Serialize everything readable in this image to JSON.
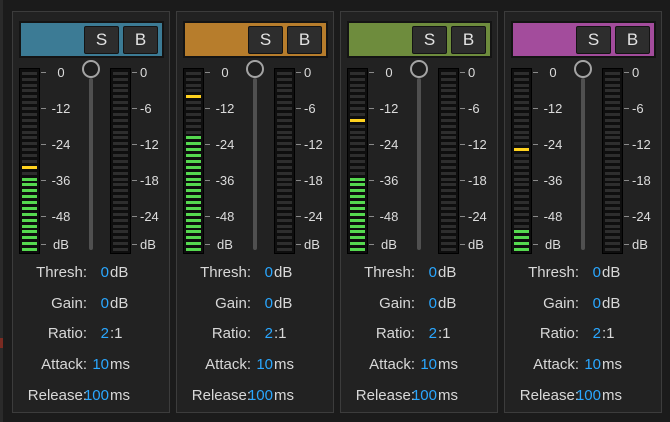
{
  "bands": [
    {
      "color": "#3c7b95",
      "solo_label": "S",
      "bypass_label": "B",
      "input_level_db": -33,
      "input_peak_db": -31,
      "gain_reduction_db": 0,
      "threshold_knob_db": 0,
      "params": {
        "thresh": {
          "label": "Thresh:",
          "value": "0",
          "unit": "dB"
        },
        "gain": {
          "label": "Gain:",
          "value": "0",
          "unit": "dB"
        },
        "ratio": {
          "label": "Ratio:",
          "value": "2",
          "unit": ":1"
        },
        "attack": {
          "label": "Attack:",
          "value": "10",
          "unit": "ms"
        },
        "release": {
          "label": "Release:",
          "value": "100",
          "unit": "ms"
        }
      }
    },
    {
      "color": "#b77d2c",
      "solo_label": "S",
      "bypass_label": "B",
      "input_level_db": -20,
      "input_peak_db": -8,
      "gain_reduction_db": 0,
      "threshold_knob_db": 0,
      "params": {
        "thresh": {
          "label": "Thresh:",
          "value": "0",
          "unit": "dB"
        },
        "gain": {
          "label": "Gain:",
          "value": "0",
          "unit": "dB"
        },
        "ratio": {
          "label": "Ratio:",
          "value": "2",
          "unit": ":1"
        },
        "attack": {
          "label": "Attack:",
          "value": "10",
          "unit": "ms"
        },
        "release": {
          "label": "Release:",
          "value": "100",
          "unit": "ms"
        }
      }
    },
    {
      "color": "#6e8c3d",
      "solo_label": "S",
      "bypass_label": "B",
      "input_level_db": -33,
      "input_peak_db": -16,
      "gain_reduction_db": 0,
      "threshold_knob_db": 0,
      "params": {
        "thresh": {
          "label": "Thresh:",
          "value": "0",
          "unit": "dB"
        },
        "gain": {
          "label": "Gain:",
          "value": "0",
          "unit": "dB"
        },
        "ratio": {
          "label": "Ratio:",
          "value": "2",
          "unit": ":1"
        },
        "attack": {
          "label": "Attack:",
          "value": "10",
          "unit": "ms"
        },
        "release": {
          "label": "Release:",
          "value": "100",
          "unit": "ms"
        }
      }
    },
    {
      "color": "#a34c9c",
      "solo_label": "S",
      "bypass_label": "B",
      "input_level_db": -52,
      "input_peak_db": -26,
      "gain_reduction_db": 0,
      "threshold_knob_db": 0,
      "params": {
        "thresh": {
          "label": "Thresh:",
          "value": "0",
          "unit": "dB"
        },
        "gain": {
          "label": "Gain:",
          "value": "0",
          "unit": "dB"
        },
        "ratio": {
          "label": "Ratio:",
          "value": "2",
          "unit": ":1"
        },
        "attack": {
          "label": "Attack:",
          "value": "10",
          "unit": "ms"
        },
        "release": {
          "label": "Release:",
          "value": "100",
          "unit": "ms"
        }
      }
    }
  ],
  "input_scale": [
    "0",
    "-12",
    "-24",
    "-36",
    "-48",
    "dB"
  ],
  "gr_scale": [
    "0",
    "-6",
    "-12",
    "-18",
    "-24",
    "dB"
  ],
  "input_scale_range_db": [
    -60,
    0
  ],
  "gr_scale_range_db": [
    -30,
    0
  ],
  "meter_colors": {
    "on": "#55d84f",
    "off": "#2e2e2e",
    "peak": "#ffd21f"
  },
  "value_color": "#2aa7ff"
}
